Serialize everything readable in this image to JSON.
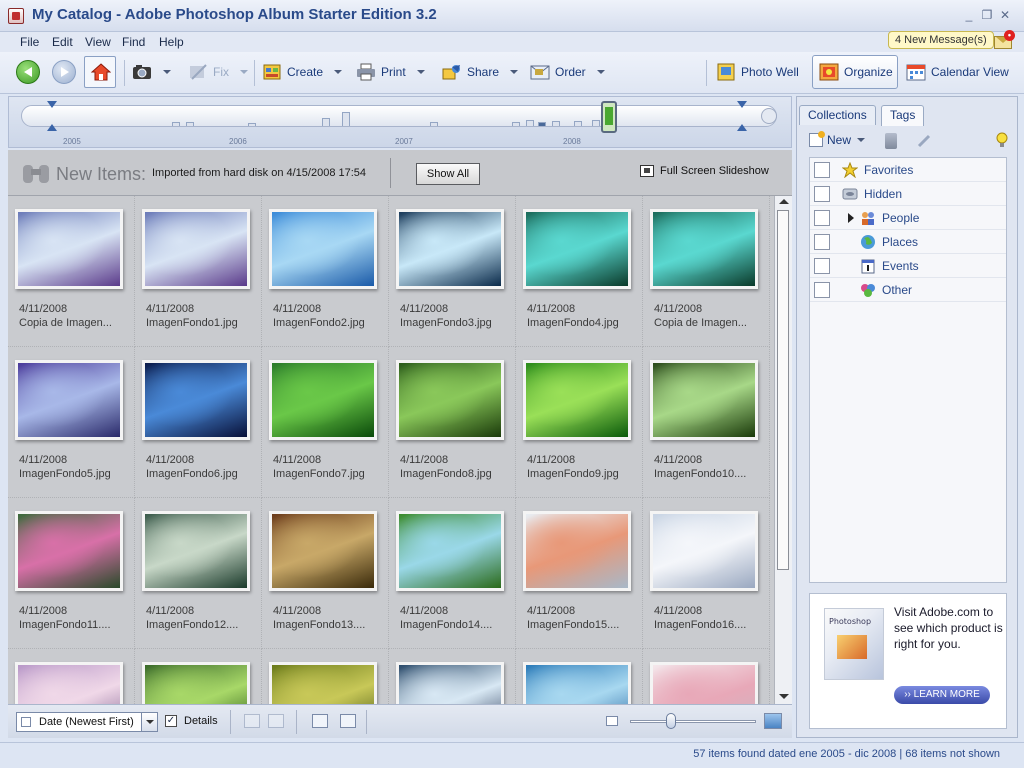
{
  "window": {
    "title": "My Catalog - Adobe Photoshop Album Starter Edition 3.2",
    "controls": [
      "_",
      "❐",
      "✕"
    ]
  },
  "menu": [
    "File",
    "Edit",
    "View",
    "Find",
    "Help"
  ],
  "messages": {
    "label": "4 New Message(s)",
    "badge": "•"
  },
  "toolbar": {
    "fix": "Fix",
    "create": "Create",
    "print": "Print",
    "share": "Share",
    "order": "Order",
    "photo_well": "Photo Well",
    "organize": "Organize",
    "calendar_view": "Calendar View"
  },
  "timeline": {
    "years": [
      "2005",
      "2006",
      "2007",
      "2008"
    ]
  },
  "new_items": {
    "title": "New Items:",
    "description": "Imported from hard disk on 4/15/2008 17:54",
    "show_all": "Show All",
    "slideshow": "Full Screen Slideshow"
  },
  "photos": [
    {
      "date": "4/11/2008",
      "name": "Copia de Imagen...",
      "colors": [
        "#6a7ab8",
        "#d8e4f4",
        "#5a3a8a"
      ]
    },
    {
      "date": "4/11/2008",
      "name": "ImagenFondo1.jpg",
      "colors": [
        "#6a7ab8",
        "#d8e4f4",
        "#5a3a8a"
      ]
    },
    {
      "date": "4/11/2008",
      "name": "ImagenFondo2.jpg",
      "colors": [
        "#3a8ad8",
        "#a8d8f4",
        "#1a5aa8"
      ]
    },
    {
      "date": "4/11/2008",
      "name": "ImagenFondo3.jpg",
      "colors": [
        "#1a3a5a",
        "#c8e8f8",
        "#0a2a4a"
      ]
    },
    {
      "date": "4/11/2008",
      "name": "ImagenFondo4.jpg",
      "colors": [
        "#1a6a5a",
        "#5ad8d0",
        "#0a3a2a"
      ]
    },
    {
      "date": "4/11/2008",
      "name": "Copia de Imagen...",
      "colors": [
        "#1a6a5a",
        "#5ad8d0",
        "#0a3a2a"
      ]
    },
    {
      "date": "4/11/2008",
      "name": "ImagenFondo5.jpg",
      "colors": [
        "#4a3a9a",
        "#a8b8e8",
        "#2a2a6a"
      ]
    },
    {
      "date": "4/11/2008",
      "name": "ImagenFondo6.jpg",
      "colors": [
        "#0a1a4a",
        "#4a8ad8",
        "#081038"
      ]
    },
    {
      "date": "4/11/2008",
      "name": "ImagenFondo7.jpg",
      "colors": [
        "#2a7a2a",
        "#6ac848",
        "#0a4a0a"
      ]
    },
    {
      "date": "4/11/2008",
      "name": "ImagenFondo8.jpg",
      "colors": [
        "#2a5a1a",
        "#8ac85a",
        "#1a3a0a"
      ]
    },
    {
      "date": "4/11/2008",
      "name": "ImagenFondo9.jpg",
      "colors": [
        "#2a8a1a",
        "#9ae058",
        "#0a5a0a"
      ]
    },
    {
      "date": "4/11/2008",
      "name": "ImagenFondo10....",
      "colors": [
        "#2a4a1a",
        "#a8d888",
        "#1a3a0a"
      ]
    },
    {
      "date": "4/11/2008",
      "name": "ImagenFondo11....",
      "colors": [
        "#3a6a3a",
        "#d870a8",
        "#2a4a2a"
      ]
    },
    {
      "date": "4/11/2008",
      "name": "ImagenFondo12....",
      "colors": [
        "#3a5a4a",
        "#c8d8c8",
        "#1a3a2a"
      ]
    },
    {
      "date": "4/11/2008",
      "name": "ImagenFondo13....",
      "colors": [
        "#6a3a1a",
        "#c8a868",
        "#3a2a0a"
      ]
    },
    {
      "date": "4/11/2008",
      "name": "ImagenFondo14....",
      "colors": [
        "#3a8a2a",
        "#9ad8e8",
        "#2a6a1a"
      ]
    },
    {
      "date": "4/11/2008",
      "name": "ImagenFondo15....",
      "colors": [
        "#e8eef4",
        "#e89878",
        "#a8b8c8"
      ]
    },
    {
      "date": "4/11/2008",
      "name": "ImagenFondo16....",
      "colors": [
        "#c8d4e4",
        "#f4f6fa",
        "#9aa8c0"
      ]
    },
    {
      "date": "",
      "name": "",
      "colors": [
        "#b898c8",
        "#f0d8e8",
        "#7a5a8a"
      ]
    },
    {
      "date": "",
      "name": "",
      "colors": [
        "#3a6a2a",
        "#a8d868",
        "#1a4a0a"
      ]
    },
    {
      "date": "",
      "name": "",
      "colors": [
        "#6a7a1a",
        "#c8c858",
        "#3a4a0a"
      ]
    },
    {
      "date": "",
      "name": "",
      "colors": [
        "#2a4a6a",
        "#d8e8f4",
        "#1a2a4a"
      ]
    },
    {
      "date": "",
      "name": "",
      "colors": [
        "#2a7ab8",
        "#a8d8f0",
        "#1a5a98"
      ]
    },
    {
      "date": "",
      "name": "",
      "colors": [
        "#f4e8ec",
        "#e8a8b8",
        "#c8b8c0"
      ]
    }
  ],
  "bottom": {
    "sort": "Date (Newest First)",
    "details": "Details",
    "details_checked": "✓"
  },
  "panel": {
    "tabs": [
      "Collections",
      "Tags"
    ],
    "new_label": "New",
    "tags": [
      {
        "label": "Favorites"
      },
      {
        "label": "Hidden"
      },
      {
        "label": "People"
      },
      {
        "label": "Places"
      },
      {
        "label": "Events"
      },
      {
        "label": "Other"
      }
    ],
    "ad": {
      "text": "Visit Adobe.com to see which product is right for you.",
      "button": "›› LEARN MORE"
    }
  },
  "status": {
    "text": "57 items found dated ene 2005 - dic 2008  |  68 items not shown"
  }
}
